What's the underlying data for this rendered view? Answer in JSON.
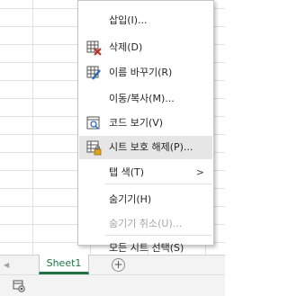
{
  "sheet_tab": {
    "name": "Sheet1"
  },
  "tab_bar": {
    "add_label": "+",
    "scroll_left": "◀"
  },
  "context_menu": {
    "items": [
      {
        "label": "삽입(I)...",
        "icon": "none"
      },
      {
        "label": "삭제(D)",
        "icon": "delete-sheet-icon"
      },
      {
        "label": "이름 바꾸기(R)",
        "icon": "rename-icon"
      },
      {
        "label": "이동/복사(M)...",
        "icon": "none"
      },
      {
        "label": "코드 보기(V)",
        "icon": "view-code-icon"
      },
      {
        "label": "시트 보호 해제(P)...",
        "icon": "unprotect-sheet-icon",
        "highlighted": true
      },
      {
        "label": "탭 색(T)",
        "icon": "none",
        "has_submenu": true
      },
      {
        "label": "숨기기(H)",
        "icon": "none"
      },
      {
        "label": "숨기기 취소(U)...",
        "icon": "none",
        "disabled": true
      },
      {
        "label": "모든 시트 선택(S)",
        "icon": "none"
      }
    ]
  },
  "colors": {
    "accent": "#217346",
    "highlight": "#e6e6e6",
    "disabled_text": "#a6a6a6"
  }
}
